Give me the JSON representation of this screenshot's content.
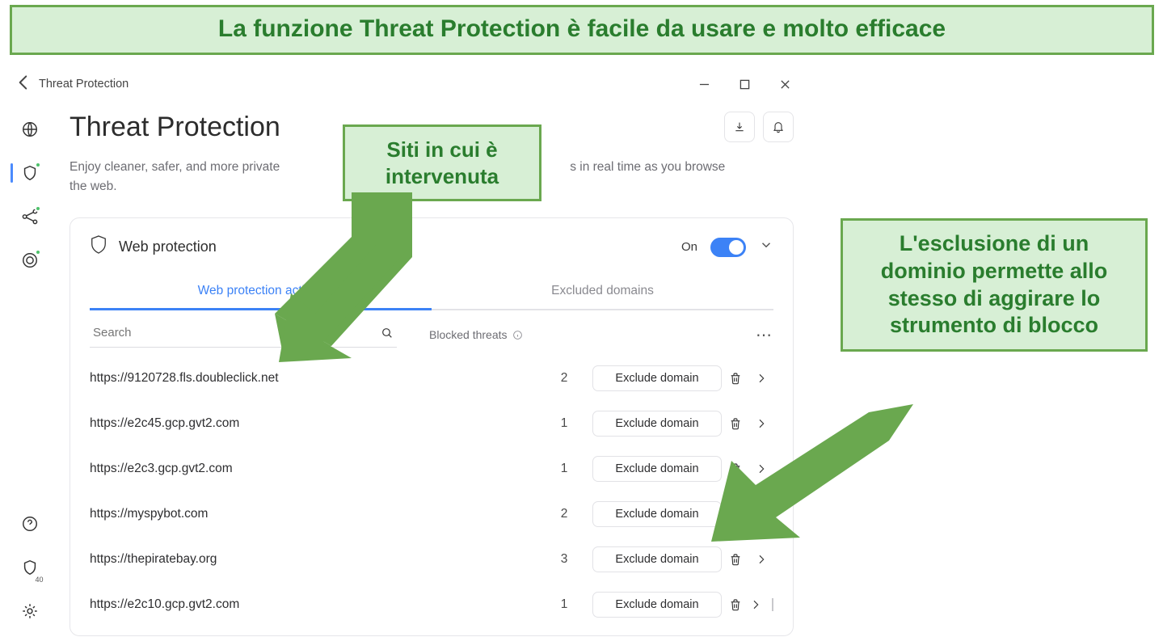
{
  "banner": "La funzione Threat Protection è facile da usare e molto efficace",
  "callout_sites": "Siti in cui è intervenuta",
  "callout_exclusion": "L'esclusione di un dominio permette allo stesso di aggirare lo strumento di blocco",
  "titlebar": {
    "title": "Threat Protection"
  },
  "leftrail": {
    "badge": "40"
  },
  "header": {
    "title": "Threat Protection",
    "subtitle_full": "Enjoy cleaner, safer, and more private browsing. Threat Protection neutralizes cyber threats in real time as you browse the web.",
    "subtitle_visible_prefix": "Enjoy cleaner, safer, and more private",
    "subtitle_visible_suffix": "s in real time as you browse the web."
  },
  "card": {
    "title": "Web protection",
    "status": "On",
    "tabs": {
      "activity": "Web protection activity",
      "excluded": "Excluded domains"
    },
    "search_placeholder": "Search",
    "blocked_threats_label": "Blocked threats",
    "exclude_label": "Exclude domain",
    "rows": [
      {
        "url": "https://9120728.fls.doubleclick.net",
        "count": "2"
      },
      {
        "url": "https://e2c45.gcp.gvt2.com",
        "count": "1"
      },
      {
        "url": "https://e2c3.gcp.gvt2.com",
        "count": "1"
      },
      {
        "url": "https://myspybot.com",
        "count": "2"
      },
      {
        "url": "https://thepiratebay.org",
        "count": "3"
      },
      {
        "url": "https://e2c10.gcp.gvt2.com",
        "count": "1"
      }
    ]
  }
}
